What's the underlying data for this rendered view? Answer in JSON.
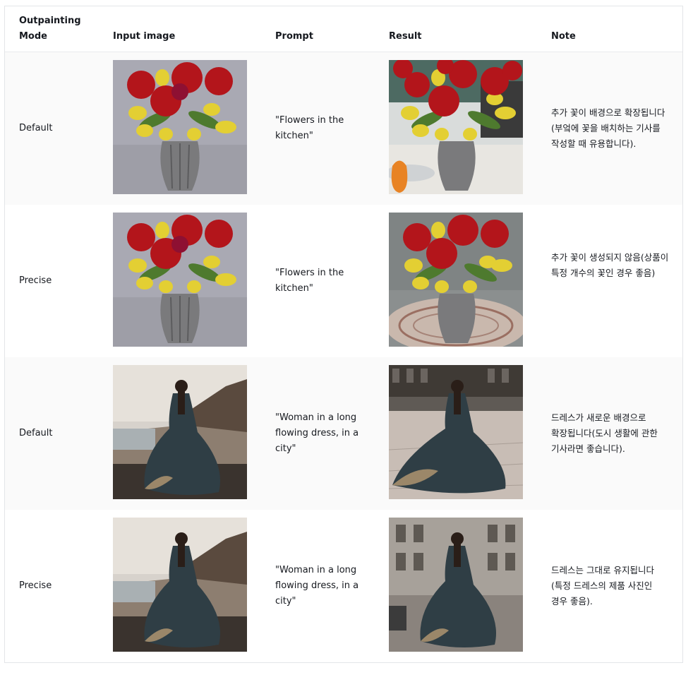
{
  "table": {
    "headers": {
      "mode_line1": "Outpainting",
      "mode_line2": "Mode",
      "input": "Input image",
      "prompt": "Prompt",
      "result": "Result",
      "note": "Note"
    },
    "rows": [
      {
        "mode": "Default",
        "input_image": "flowers-vase-photo",
        "prompt": "\"Flowers in the kitchen\"",
        "result_image": "flowers-kitchen-default-photo",
        "note": "추가 꽃이 배경으로 확장됩니다(부엌에 꽃을 배치하는 기사를 작성할 때 유용합니다)."
      },
      {
        "mode": "Precise",
        "input_image": "flowers-vase-photo",
        "prompt": "\"Flowers in the kitchen\"",
        "result_image": "flowers-kitchen-precise-photo",
        "note": "추가 꽃이 생성되지 않음(상품이 특정 개수의 꽃인 경우 좋음)"
      },
      {
        "mode": "Default",
        "input_image": "woman-beach-photo",
        "prompt": "\"Woman in a long flowing dress, in a city\"",
        "result_image": "woman-city-default-photo",
        "note": "드레스가 새로운 배경으로 확장됩니다(도시 생활에 관한 기사라면 좋습니다)."
      },
      {
        "mode": "Precise",
        "input_image": "woman-beach-photo",
        "prompt": "\"Woman in a long flowing dress, in a city\"",
        "result_image": "woman-city-precise-photo",
        "note": "드레스는 그대로 유지됩니다(특정 드레스의 제품 사진인 경우 좋음)."
      }
    ]
  }
}
